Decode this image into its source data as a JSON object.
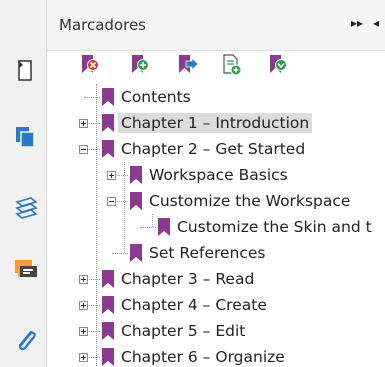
{
  "panel": {
    "title": "Marcadores",
    "menu_glyph": "▸▸",
    "options_glyph": "◂"
  },
  "left_toolbar": [
    {
      "name": "page-thumbnails-icon"
    },
    {
      "name": "layers-copy-icon"
    },
    {
      "name": "stacked-layers-icon"
    },
    {
      "name": "comments-icon"
    },
    {
      "name": "attachments-icon"
    }
  ],
  "bookmark_toolbar": [
    {
      "name": "delete-bookmark-icon"
    },
    {
      "name": "new-bookmark-icon"
    },
    {
      "name": "move-bookmark-icon"
    },
    {
      "name": "new-bookmark-from-structure-icon"
    },
    {
      "name": "expand-bookmark-icon"
    }
  ],
  "tree": [
    {
      "label": "Contents",
      "level": 0,
      "expander": "none",
      "selected": false
    },
    {
      "label": "Chapter 1 – Introduction",
      "level": 0,
      "expander": "plus",
      "selected": true
    },
    {
      "label": "Chapter 2 – Get Started",
      "level": 0,
      "expander": "minus",
      "selected": false
    },
    {
      "label": "Workspace Basics",
      "level": 1,
      "expander": "plus",
      "selected": false
    },
    {
      "label": "Customize the Workspace",
      "level": 1,
      "expander": "minus",
      "selected": false
    },
    {
      "label": "Customize the Skin and t",
      "level": 2,
      "expander": "none",
      "selected": false
    },
    {
      "label": "Set References",
      "level": 1,
      "expander": "none",
      "selected": false
    },
    {
      "label": "Chapter 3 – Read",
      "level": 0,
      "expander": "plus",
      "selected": false
    },
    {
      "label": "Chapter 4 – Create",
      "level": 0,
      "expander": "plus",
      "selected": false
    },
    {
      "label": "Chapter 5 – Edit",
      "level": 0,
      "expander": "plus",
      "selected": false
    },
    {
      "label": "Chapter 6 – Organize",
      "level": 0,
      "expander": "plus",
      "selected": false
    }
  ],
  "colors": {
    "bookmark_flag": "#8b3a8f",
    "selection": "#dcdcdc",
    "blue_icon": "#2b78c5",
    "orange_icon": "#f0a030",
    "green_badge": "#2e9e4a",
    "red_badge": "#d9342b"
  }
}
